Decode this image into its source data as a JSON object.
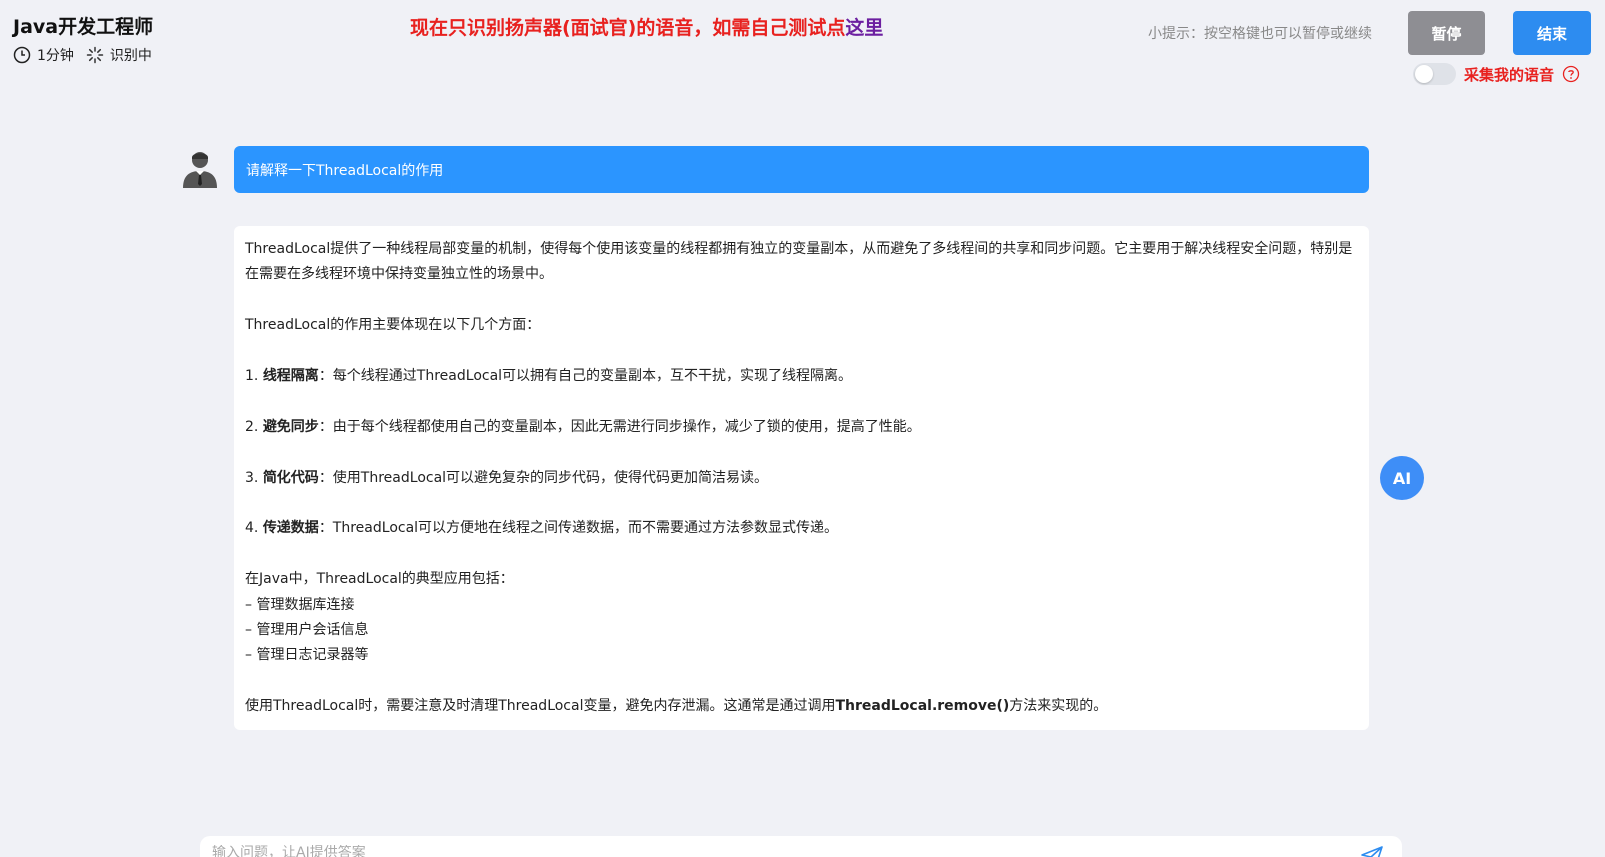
{
  "header": {
    "title": "Java开发工程师",
    "duration": "1分钟",
    "status": "识别中",
    "notice": "现在只识别扬声器(面试官)的语音，如需自己测试点",
    "notice_link": "这里",
    "tip": "小提示：按空格键也可以暂停或继续",
    "pause_label": "暂停",
    "end_label": "结束",
    "collect_label": "采集我的语音",
    "collect_enabled": false
  },
  "colors": {
    "accent": "#2d8cf0",
    "question_bg": "#2b95ff",
    "notice": "#e8211f",
    "ai_badge": "#3e8ef7"
  },
  "conversation": {
    "question": "请解释一下ThreadLocal的作用",
    "ai_badge": "AI",
    "answer": {
      "intro": "ThreadLocal提供了一种线程局部变量的机制，使得每个使用该变量的线程都拥有独立的变量副本，从而避免了多线程间的共享和同步问题。它主要用于解决线程安全问题，特别是在需要在多线程环境中保持变量独立性的场景中。",
      "lead": "ThreadLocal的作用主要体现在以下几个方面：",
      "points": [
        {
          "num": "1.",
          "title": "线程隔离",
          "text": "：每个线程通过ThreadLocal可以拥有自己的变量副本，互不干扰，实现了线程隔离。"
        },
        {
          "num": "2.",
          "title": "避免同步",
          "text": "：由于每个线程都使用自己的变量副本，因此无需进行同步操作，减少了锁的使用，提高了性能。"
        },
        {
          "num": "3.",
          "title": "简化代码",
          "text": "：使用ThreadLocal可以避免复杂的同步代码，使得代码更加简洁易读。"
        },
        {
          "num": "4.",
          "title": "传递数据",
          "text": "：ThreadLocal可以方便地在线程之间传递数据，而不需要通过方法参数显式传递。"
        }
      ],
      "java_lead": "在Java中，ThreadLocal的典型应用包括：",
      "uses": [
        "– 管理数据库连接",
        "– 管理用户会话信息",
        "– 管理日志记录器等"
      ],
      "closing_pre": "使用ThreadLocal时，需要注意及时清理ThreadLocal变量，避免内存泄漏。这通常是通过调用",
      "closing_bold": "ThreadLocal.remove()",
      "closing_post": "方法来实现的。"
    }
  },
  "input": {
    "placeholder": "输入问题，让AI提供答案",
    "value": ""
  },
  "icons": {
    "clock": "clock-icon",
    "loading": "loading-icon",
    "help": "help-circle-icon",
    "user_avatar": "user-avatar-icon",
    "send": "send-icon"
  }
}
